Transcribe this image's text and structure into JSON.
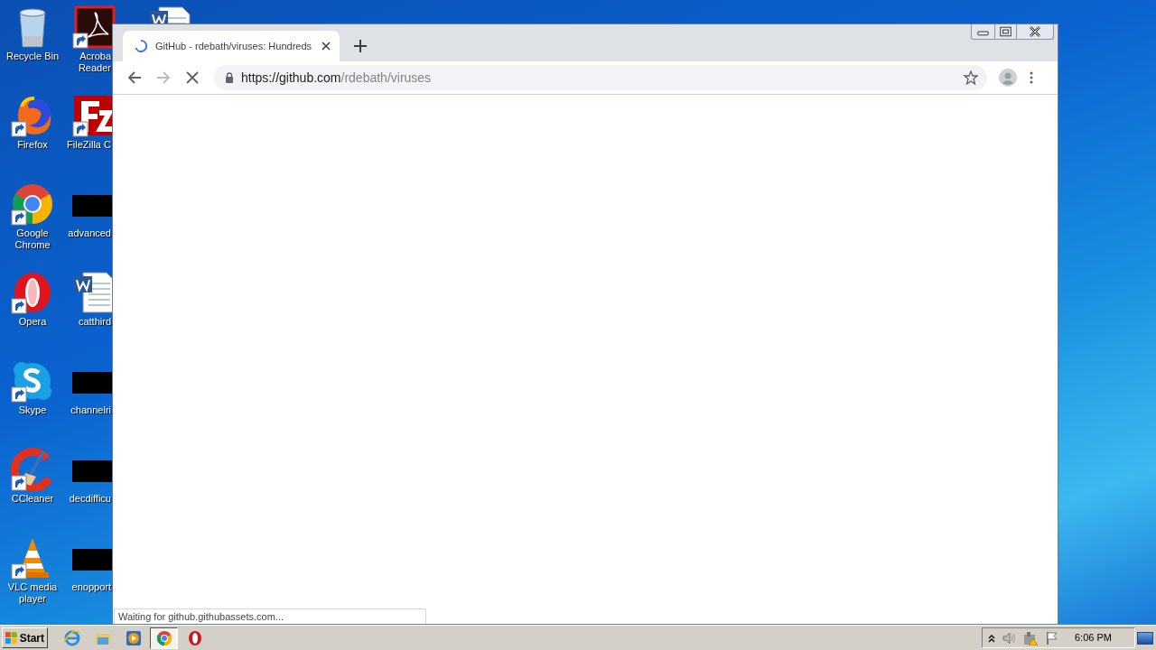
{
  "desktop_columns": [
    {
      "icons": [
        {
          "kind": "recycle-bin",
          "shortcut": false,
          "label_lines": [
            "Recycle Bin"
          ]
        },
        {
          "kind": "firefox",
          "shortcut": true,
          "label_lines": [
            "Firefox"
          ]
        },
        {
          "kind": "chrome",
          "shortcut": true,
          "label_lines": [
            "Google",
            "Chrome"
          ]
        },
        {
          "kind": "opera",
          "shortcut": true,
          "label_lines": [
            "Opera"
          ]
        },
        {
          "kind": "skype",
          "shortcut": true,
          "label_lines": [
            "Skype"
          ]
        },
        {
          "kind": "ccleaner",
          "shortcut": true,
          "label_lines": [
            "CCleaner"
          ]
        },
        {
          "kind": "vlc",
          "shortcut": true,
          "label_lines": [
            "VLC media",
            "player"
          ]
        }
      ]
    },
    {
      "icons": [
        {
          "kind": "acrobat",
          "shortcut": true,
          "label_lines": [
            "Acroba",
            "Reader"
          ]
        },
        {
          "kind": "filezilla",
          "shortcut": true,
          "label_lines": [
            "FileZilla C"
          ]
        },
        {
          "kind": "blank",
          "shortcut": false,
          "label_lines": [
            "advanced"
          ]
        },
        {
          "kind": "word",
          "shortcut": false,
          "label_lines": [
            "catthird"
          ]
        },
        {
          "kind": "blank",
          "shortcut": false,
          "label_lines": [
            "channelri"
          ]
        },
        {
          "kind": "blank",
          "shortcut": false,
          "label_lines": [
            "decdifficu"
          ]
        },
        {
          "kind": "blank",
          "shortcut": false,
          "label_lines": [
            "enopport"
          ]
        }
      ]
    },
    {
      "icons": [
        {
          "kind": "word"
        }
      ]
    }
  ],
  "browser": {
    "tab": {
      "title": "GitHub - rdebath/viruses: Hundreds",
      "loading": true
    },
    "url_host": "https://github.com",
    "url_path": "/rdebath/viruses",
    "status": "Waiting for github.githubassets.com..."
  },
  "taskbar": {
    "start": "Start",
    "apps": [
      {
        "kind": "ie",
        "selected": false
      },
      {
        "kind": "explorer",
        "selected": false
      },
      {
        "kind": "media",
        "selected": false
      },
      {
        "kind": "chrome",
        "selected": true
      },
      {
        "kind": "opera",
        "selected": false
      }
    ],
    "clock": "6:06 PM"
  }
}
